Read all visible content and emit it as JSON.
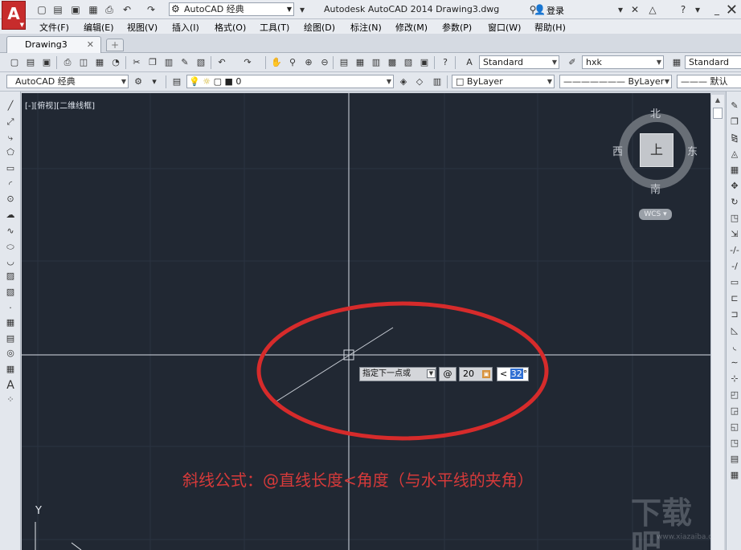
{
  "window": {
    "title": "Autodesk AutoCAD 2014    Drawing3.dwg",
    "workspace": "AutoCAD 经典",
    "login": "登录"
  },
  "menu": [
    "文件(F)",
    "编辑(E)",
    "视图(V)",
    "插入(I)",
    "格式(O)",
    "工具(T)",
    "绘图(D)",
    "标注(N)",
    "修改(M)",
    "参数(P)",
    "窗口(W)",
    "帮助(H)"
  ],
  "tabs": {
    "active": "Drawing3"
  },
  "toolbar1": {
    "text_style": "Standard",
    "dim_style": "hxk",
    "table_style": "Standard"
  },
  "toolbar2": {
    "workspace": "AutoCAD 经典",
    "layer": "0",
    "color": "ByLayer",
    "linetype": "ByLayer",
    "lineweight": "默认"
  },
  "canvas": {
    "viewport_label": "[-][俯视][二维线框]",
    "background": "#212833",
    "viewcube": {
      "north": "北",
      "south": "南",
      "east": "东",
      "west": "西",
      "face": "上",
      "wcs": "WCS"
    },
    "ucs_y": "Y"
  },
  "dynamic_input": {
    "prompt": "指定下一点或",
    "at_symbol": "@",
    "length": "20",
    "angle_prefix": "<",
    "angle_value": "32",
    "angle_suffix": "°"
  },
  "annotation": {
    "text": "斜线公式：@直线长度<角度（与水平线的夹角）",
    "color": "#d63a3a"
  },
  "watermark": {
    "text": "下载吧",
    "site": "www.xiazaiba.com"
  },
  "colors": {
    "accent_red": "#c72c2c",
    "ellipse_red": "#d62b2b",
    "crosshair": "#d8dde5"
  }
}
